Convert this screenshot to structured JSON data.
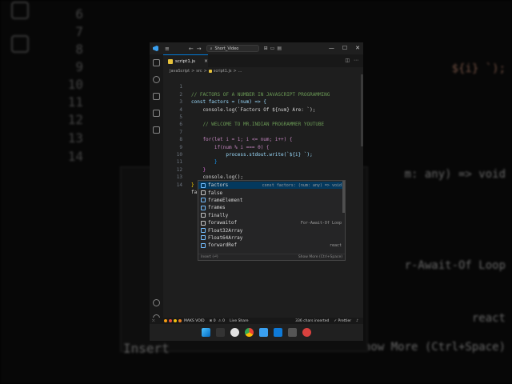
{
  "window": {
    "search_text": "Short_Video",
    "menu_glyph": "≡",
    "nav_back": "←",
    "nav_forward": "→",
    "win_min": "—",
    "win_max": "☐",
    "win_close": "✕"
  },
  "tabs": [
    {
      "label": "script1.js",
      "close": "×"
    }
  ],
  "breadcrumb": {
    "lang": "JavaScript",
    "sep": ">",
    "folder": "src",
    "file": "script1.js",
    "item": "..."
  },
  "editor": {
    "line_numbers": [
      "1",
      "2",
      "3",
      "4",
      "5",
      "6",
      "7",
      "8",
      "9",
      "10",
      "11",
      "12",
      "13",
      "14"
    ],
    "lines": [
      "// FACTORS OF A NUMBER IN JAVASCRIPT PROGRAMMING",
      "const factors = (num) => {",
      "    console.log(`Factors Of ${num} Are: `);",
      "",
      "    // WELCOME TO MR.INDIAN PROGRAMMER YOUTUBE",
      "",
      "    for(let i = 1; i <= num; i++) {",
      "        if(num % i === 0) {",
      "            process.stdout.write(`${i} `);",
      "        }",
      "    }",
      "    console.log();",
      "}",
      "fa"
    ]
  },
  "suggest": {
    "items": [
      {
        "match": "f",
        "rest": "actors",
        "label": "factors",
        "detail": "const factors: (num: any) => void",
        "kind": "var"
      },
      {
        "match": "fa",
        "rest": "lse",
        "label": "false",
        "detail": "",
        "kind": "kw"
      },
      {
        "match": "f",
        "rest": "rameElement",
        "label": "frameElement",
        "detail": "",
        "kind": "var"
      },
      {
        "match": "f",
        "rest": "rames",
        "label": "frames",
        "detail": "",
        "kind": "var"
      },
      {
        "match": "f",
        "rest": "inally",
        "label": "finally",
        "detail": "",
        "kind": "kw"
      },
      {
        "match": "f",
        "rest": "orawaitof",
        "label": "forawaitof",
        "detail": "For-Await-Of Loop",
        "kind": "kw"
      },
      {
        "match": "F",
        "rest": "loat32Array",
        "label": "Float32Array",
        "detail": "",
        "kind": "var"
      },
      {
        "match": "F",
        "rest": "loat64Array",
        "label": "Float64Array",
        "detail": "",
        "kind": "var"
      },
      {
        "match": "f",
        "rest": "orwardRef",
        "label": "forwardRef",
        "detail": "react",
        "kind": "var"
      }
    ],
    "footer_left": "Insert (⏎)",
    "footer_right": "Show More (Ctrl+Space)"
  },
  "status": {
    "project": "MAKS VOID",
    "errors": "⊗ 0",
    "warnings": "⚠ 0",
    "live_share": "Live Share",
    "chars": "336 chars inserted",
    "prettier": "✓ Prettier"
  },
  "background": {
    "lines": [
      "6",
      "7",
      "8",
      "9",
      "10",
      "11",
      "12",
      "13",
      "14"
    ],
    "right_texts": [
      "${i} `);",
      "m: any) => void",
      "r-Await-Of Loop",
      "react",
      "Show More (Ctrl+Space)"
    ],
    "insert_text": "Insert"
  },
  "colors": {
    "accent": "#0078d4",
    "editor_bg": "#1e1e1e",
    "suggest_selected": "#04395e"
  }
}
